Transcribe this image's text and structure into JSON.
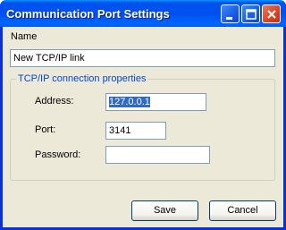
{
  "window": {
    "title": "Communication Port Settings",
    "buttons": {
      "minimize_icon": "minimize-icon",
      "maximize_icon": "maximize-icon",
      "close_icon": "close-icon"
    }
  },
  "form": {
    "name_label": "Name",
    "name_value": "New TCP/IP link",
    "group_title": "TCP/IP connection properties",
    "address_label": "Address:",
    "address_value": "127.0.0.1",
    "port_label": "Port:",
    "port_value": "3141",
    "password_label": "Password:",
    "password_value": ""
  },
  "actions": {
    "save_label": "Save",
    "cancel_label": "Cancel"
  },
  "colors": {
    "title_bar": "#0054e3",
    "group_title": "#0046d5",
    "dialog_bg": "#ece9d8",
    "selection": "#316ac5",
    "close_button": "#d9431f"
  }
}
